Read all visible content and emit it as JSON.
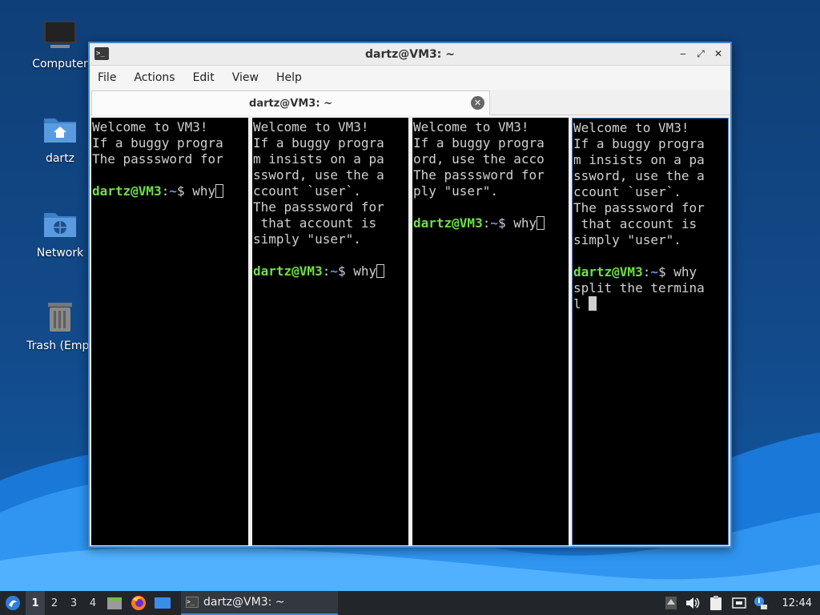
{
  "desktop": {
    "icons": [
      {
        "label": "Computer",
        "icon": "computer-icon"
      },
      {
        "label": "dartz",
        "icon": "home-folder-icon"
      },
      {
        "label": "Network",
        "icon": "network-folder-icon"
      },
      {
        "label": "Trash (Empt",
        "icon": "trash-icon"
      }
    ]
  },
  "window": {
    "title": "dartz@VM3: ~",
    "controls": {
      "minimize": "‒",
      "maximize": "⤢",
      "close": "✕"
    },
    "menu": [
      "File",
      "Actions",
      "Edit",
      "View",
      "Help"
    ],
    "tab": {
      "label": "dartz@VM3: ~",
      "close": "✕"
    }
  },
  "terminal": {
    "user": "dartz@VM3",
    "path": "~",
    "panes": [
      {
        "lines": [
          "Welcome to VM3!",
          "If a buggy progra",
          "The passsword for",
          ""
        ],
        "prompt_cmd": " why",
        "after": []
      },
      {
        "lines": [
          "Welcome to VM3!",
          "If a buggy progra",
          "m insists on a pa",
          "ssword, use the a",
          "ccount `user`.",
          "The passsword for",
          " that account is",
          "simply \"user\".",
          ""
        ],
        "prompt_cmd": " why",
        "after": []
      },
      {
        "lines": [
          "Welcome to VM3!",
          "If a buggy progra",
          "ord, use the acco",
          "The passsword for",
          "ply \"user\".",
          ""
        ],
        "prompt_cmd": " why",
        "after": []
      },
      {
        "lines": [
          "Welcome to VM3!",
          "If a buggy progra",
          "m insists on a pa",
          "ssword, use the a",
          "ccount `user`.",
          "The passsword for",
          " that account is",
          "simply \"user\".",
          ""
        ],
        "prompt_cmd": " why",
        "after": [
          "split the termina",
          "l "
        ]
      }
    ]
  },
  "taskbar": {
    "start_icon": "lxqt-start-icon",
    "workspaces": [
      "1",
      "2",
      "3",
      "4"
    ],
    "active_workspace": "1",
    "launchers": [
      "file-manager-icon",
      "firefox-icon",
      "show-desktop-icon"
    ],
    "task": {
      "label": "dartz@VM3: ~"
    },
    "tray": [
      "upload-icon",
      "volume-icon",
      "clipboard-icon",
      "network-icon",
      "update-icon"
    ],
    "clock": "12:44"
  },
  "colors": {
    "accent": "#4a86c8",
    "user_green": "#6ee046",
    "path_blue": "#6a8ef2",
    "desktop": "#124a8a",
    "taskbar": "#22262b"
  }
}
